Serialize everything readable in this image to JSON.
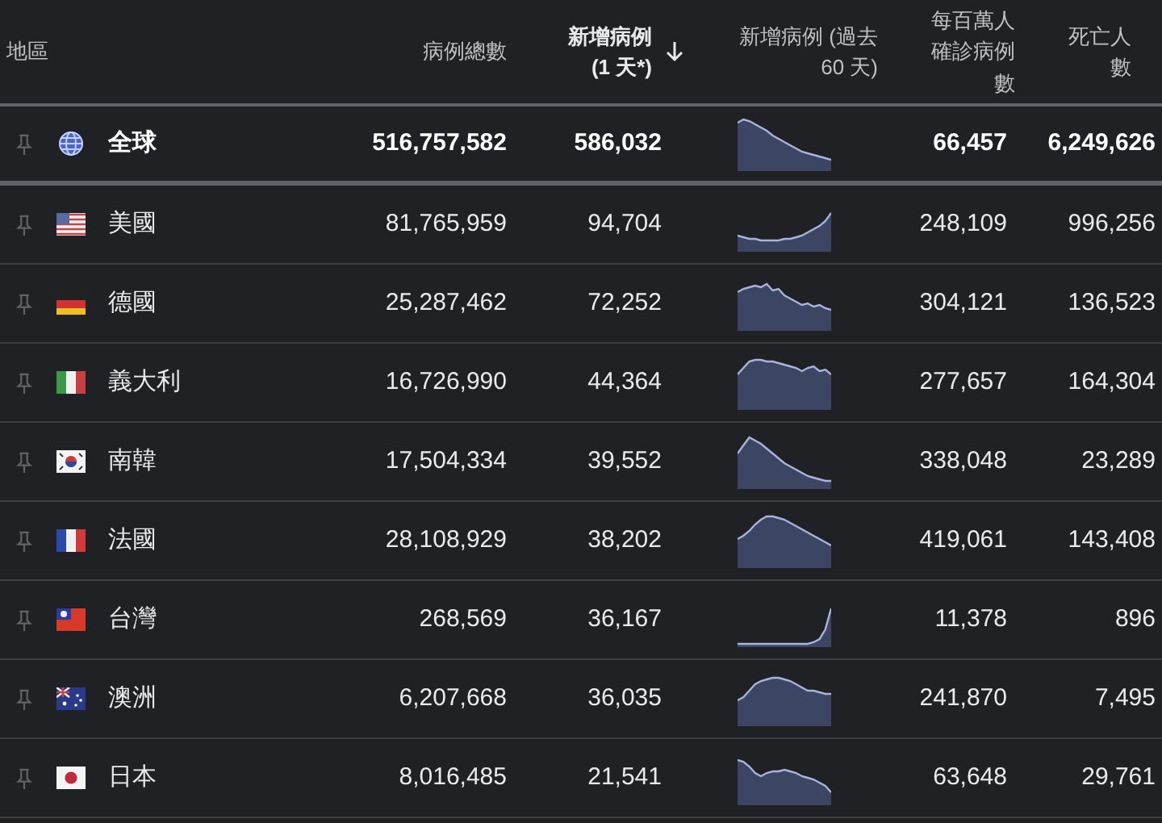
{
  "columns": [
    {
      "label": "地區",
      "sorted": false
    },
    {
      "label": "病例總數",
      "sorted": false
    },
    {
      "label": "新增病例 (1 天*)",
      "sorted": true
    },
    {
      "label": "新增病例 (過去 60 天)",
      "sorted": false
    },
    {
      "label": "每百萬人確診病例數",
      "sorted": false
    },
    {
      "label": "死亡人數",
      "sorted": false
    }
  ],
  "rows": [
    {
      "kind": "globe",
      "region": "全球",
      "total": "516,757,582",
      "new": "586,032",
      "per_million": "66,457",
      "deaths": "6,249,626",
      "highlighted": true
    },
    {
      "kind": "us",
      "region": "美國",
      "total": "81,765,959",
      "new": "94,704",
      "per_million": "248,109",
      "deaths": "996,256",
      "highlighted": false
    },
    {
      "kind": "de",
      "region": "德國",
      "total": "25,287,462",
      "new": "72,252",
      "per_million": "304,121",
      "deaths": "136,523",
      "highlighted": false
    },
    {
      "kind": "it",
      "region": "義大利",
      "total": "16,726,990",
      "new": "44,364",
      "per_million": "277,657",
      "deaths": "164,304",
      "highlighted": false
    },
    {
      "kind": "kr",
      "region": "南韓",
      "total": "17,504,334",
      "new": "39,552",
      "per_million": "338,048",
      "deaths": "23,289",
      "highlighted": false
    },
    {
      "kind": "fr",
      "region": "法國",
      "total": "28,108,929",
      "new": "38,202",
      "per_million": "419,061",
      "deaths": "143,408",
      "highlighted": false
    },
    {
      "kind": "tw",
      "region": "台灣",
      "total": "268,569",
      "new": "36,167",
      "per_million": "11,378",
      "deaths": "896",
      "highlighted": false
    },
    {
      "kind": "au",
      "region": "澳洲",
      "total": "6,207,668",
      "new": "36,035",
      "per_million": "241,870",
      "deaths": "7,495",
      "highlighted": false
    },
    {
      "kind": "jp",
      "region": "日本",
      "total": "8,016,485",
      "new": "21,541",
      "per_million": "63,648",
      "deaths": "29,761",
      "highlighted": false
    }
  ]
}
